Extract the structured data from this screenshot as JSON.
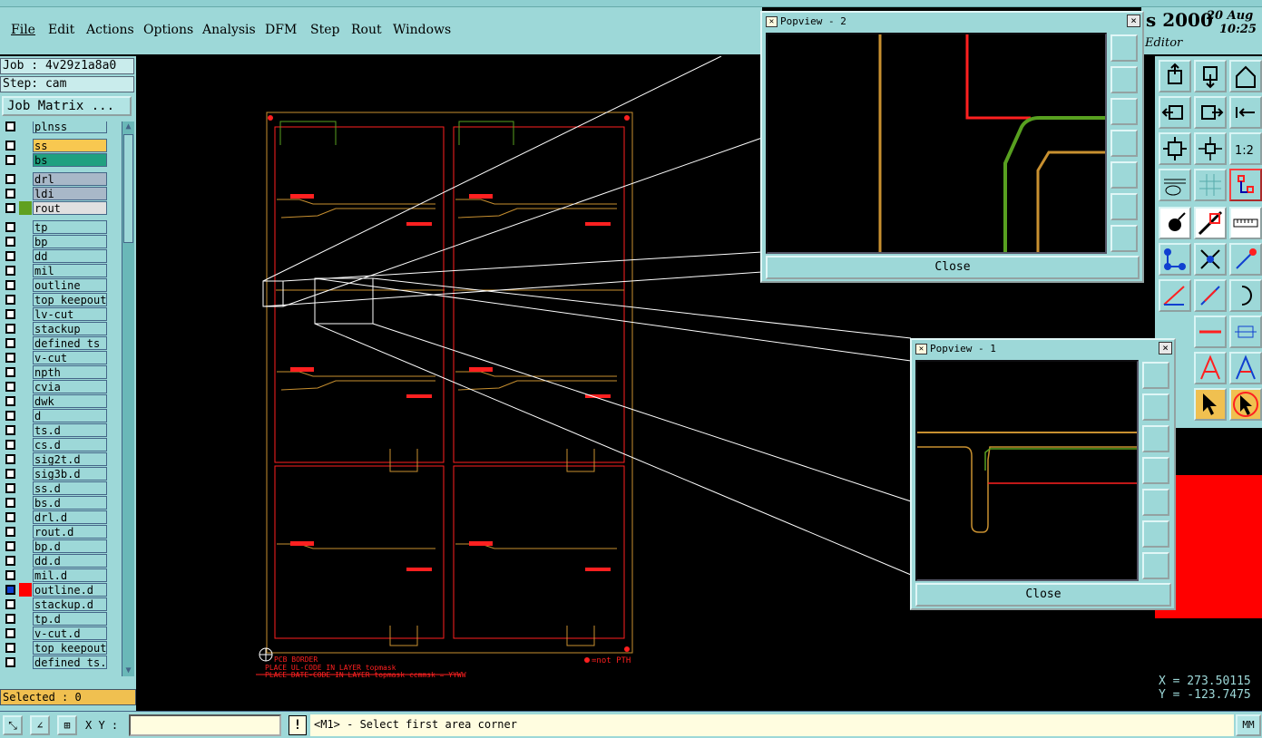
{
  "menu": [
    "File",
    "Edit",
    "Actions",
    "Options",
    "Analysis",
    "DFM",
    "Step",
    "Rout",
    "Windows"
  ],
  "brand": {
    "title": "s 2000",
    "date": "20 Aug",
    "time": "10:25",
    "editor": "Editor"
  },
  "job": {
    "job_label": "Job : 4v29z1a8a0",
    "step_label": "Step: cam",
    "matrix_button": "Job Matrix ..."
  },
  "layers": [
    {
      "name": "plnss",
      "color": "",
      "bg": "#9dd8d8"
    },
    {
      "name": "ss",
      "color": "",
      "bg": "#f8c850"
    },
    {
      "name": "bs",
      "color": "",
      "bg": "#20a080"
    },
    {
      "name": "drl",
      "color": "",
      "bg": "#a8b8c8"
    },
    {
      "name": "ldi",
      "color": "",
      "bg": "#a8b8c8"
    },
    {
      "name": "rout",
      "color": "#60a020",
      "bg": "#e0e0e0"
    },
    {
      "name": "tp",
      "color": "",
      "bg": "#9dd8d8"
    },
    {
      "name": "bp",
      "color": "",
      "bg": "#9dd8d8"
    },
    {
      "name": "dd",
      "color": "",
      "bg": "#9dd8d8"
    },
    {
      "name": "mil",
      "color": "",
      "bg": "#9dd8d8"
    },
    {
      "name": "outline",
      "color": "",
      "bg": "#9dd8d8"
    },
    {
      "name": "top_keepout",
      "color": "",
      "bg": "#9dd8d8"
    },
    {
      "name": "lv-cut",
      "color": "",
      "bg": "#9dd8d8"
    },
    {
      "name": "stackup",
      "color": "",
      "bg": "#9dd8d8"
    },
    {
      "name": "defined_ts",
      "color": "",
      "bg": "#9dd8d8"
    },
    {
      "name": "v-cut",
      "color": "",
      "bg": "#9dd8d8"
    },
    {
      "name": "npth",
      "color": "",
      "bg": "#9dd8d8"
    },
    {
      "name": "cvia",
      "color": "",
      "bg": "#9dd8d8"
    },
    {
      "name": "dwk",
      "color": "",
      "bg": "#9dd8d8"
    },
    {
      "name": "d",
      "color": "",
      "bg": "#9dd8d8"
    },
    {
      "name": "ts.d",
      "color": "",
      "bg": "#9dd8d8"
    },
    {
      "name": "cs.d",
      "color": "",
      "bg": "#9dd8d8"
    },
    {
      "name": "sig2t.d",
      "color": "",
      "bg": "#9dd8d8"
    },
    {
      "name": "sig3b.d",
      "color": "",
      "bg": "#9dd8d8"
    },
    {
      "name": "ss.d",
      "color": "",
      "bg": "#9dd8d8"
    },
    {
      "name": "bs.d",
      "color": "",
      "bg": "#9dd8d8"
    },
    {
      "name": "drl.d",
      "color": "",
      "bg": "#9dd8d8"
    },
    {
      "name": "rout.d",
      "color": "",
      "bg": "#9dd8d8"
    },
    {
      "name": "bp.d",
      "color": "",
      "bg": "#9dd8d8"
    },
    {
      "name": "dd.d",
      "color": "",
      "bg": "#9dd8d8"
    },
    {
      "name": "mil.d",
      "color": "",
      "bg": "#9dd8d8"
    },
    {
      "name": "outline.d",
      "color": "#ff0000",
      "bg": "#9dd8d8",
      "active": true
    },
    {
      "name": "stackup.d",
      "color": "",
      "bg": "#9dd8d8"
    },
    {
      "name": "tp.d",
      "color": "",
      "bg": "#9dd8d8"
    },
    {
      "name": "v-cut.d",
      "color": "",
      "bg": "#9dd8d8"
    },
    {
      "name": "top_keepout",
      "color": "",
      "bg": "#9dd8d8"
    },
    {
      "name": "defined_ts.d",
      "color": "",
      "bg": "#9dd8d8"
    }
  ],
  "selected": "Selected : 0",
  "status": {
    "xy_label": "X Y :",
    "xy_value": "",
    "excl": "!",
    "prompt": "<M1> - Select first area corner",
    "units": "MM"
  },
  "coords": {
    "x": "X = 273.50115",
    "y": "Y = -123.7475"
  },
  "canvas_text": {
    "note1": "PCB  BORDER",
    "note2": "PLACE UL-CODE IN LAYER topmask",
    "note3": "PLACE DATE-CODE IN LAYER topmask ccmmsk = YYWW",
    "legend": "=not PTH"
  },
  "popview2": {
    "title": "Popview - 2",
    "close": "Close",
    "x_glyph": "×"
  },
  "popview1": {
    "title": "Popview - 1",
    "close": "Close",
    "x_glyph": "×"
  },
  "colors": {
    "panel": "#9dd8d8",
    "trace_orange": "#c89030",
    "trace_green": "#58a020",
    "trace_red": "#ff2020"
  }
}
